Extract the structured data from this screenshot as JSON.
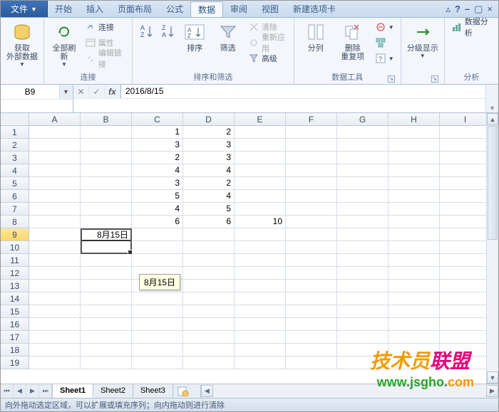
{
  "tabs": {
    "file": "文件",
    "items": [
      "开始",
      "插入",
      "页面布局",
      "公式",
      "数据",
      "审阅",
      "视图",
      "新建选项卡"
    ],
    "active_index": 4
  },
  "ribbon": {
    "g1": {
      "get_ext": "获取\n外部数据",
      "label": ""
    },
    "g2": {
      "refresh": "全部刷新",
      "conn": "连接",
      "prop": "属性",
      "edit": "编辑链接",
      "label": "连接"
    },
    "g3": {
      "sort": "排序",
      "filter": "筛选",
      "clear": "清除",
      "reapply": "重新应用",
      "adv": "高级",
      "label": "排序和筛选"
    },
    "g4": {
      "t2c": "分列",
      "rmdup": "删除\n重复项",
      "label": "数据工具"
    },
    "g5": {
      "group": "分级显示",
      "label": ""
    },
    "g6": {
      "analysis": "数据分析",
      "label": "分析"
    }
  },
  "formula": {
    "cellref": "B9",
    "value": "2016/8/15"
  },
  "columns": [
    "A",
    "B",
    "C",
    "D",
    "E",
    "F",
    "G",
    "H",
    "I"
  ],
  "rows": [
    "1",
    "2",
    "3",
    "4",
    "5",
    "6",
    "7",
    "8",
    "9",
    "10",
    "11",
    "12",
    "13",
    "14",
    "15",
    "16",
    "17",
    "18",
    "19"
  ],
  "cells": {
    "C1": "1",
    "D1": "2",
    "C2": "3",
    "D2": "3",
    "C3": "2",
    "D3": "3",
    "C4": "4",
    "D4": "4",
    "C5": "3",
    "D5": "2",
    "C6": "5",
    "D6": "4",
    "C7": "4",
    "D7": "5",
    "C8": "6",
    "D8": "6",
    "E8": "10",
    "B9": "8月15日"
  },
  "drag_tip": "8月15日",
  "sheets": {
    "items": [
      "Sheet1",
      "Sheet2",
      "Sheet3"
    ],
    "active": 0
  },
  "status": "向外拖动选定区域，可以扩展或填充序列；向内拖动则进行清除",
  "watermark": {
    "t1a": "技术员",
    "t1b": "联盟",
    "url_w": "www",
    "url_d1": ".",
    "url_j": "jsgho",
    "url_d2": ".",
    "url_c": "com"
  }
}
